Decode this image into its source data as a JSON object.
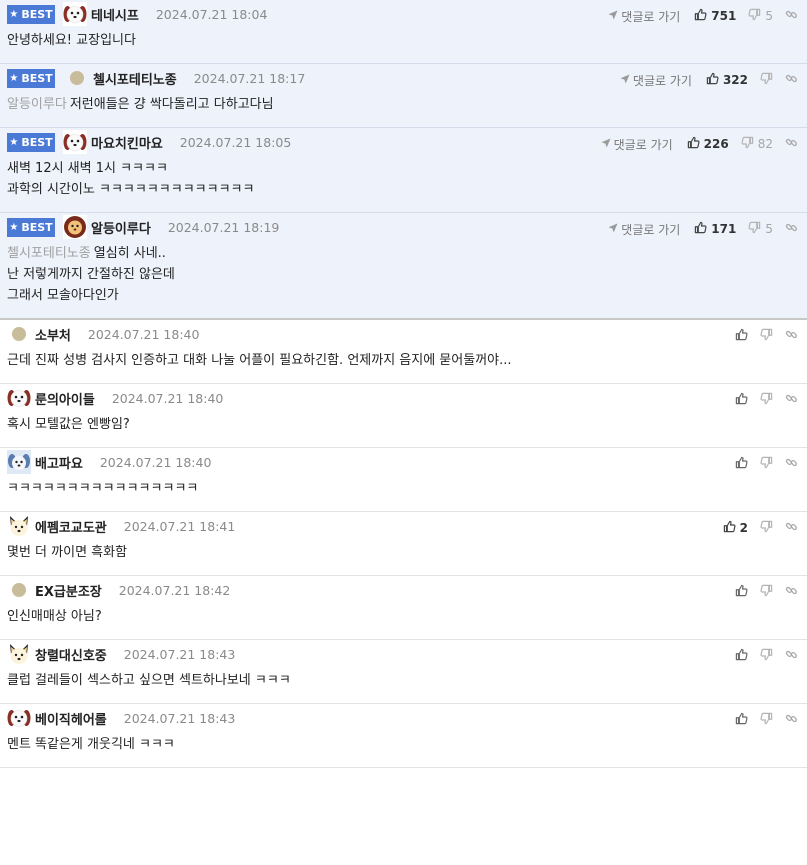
{
  "best_badge": "BEST",
  "reply_label": "댓글로 가기",
  "comments": [
    {
      "best": true,
      "nick": "테네시프",
      "date": "2024.07.21 18:04",
      "likes": "751",
      "dislikes": "5",
      "quote": "",
      "lines": [
        "안녕하세요! 교장입니다"
      ],
      "avatar": "puppy-avatar"
    },
    {
      "best": true,
      "nick": "첼시포테티노종",
      "date": "2024.07.21 18:17",
      "likes": "322",
      "dislikes": "",
      "quote": "알등이루다",
      "lines": [
        "저런애들은 걍 싹다돌리고 다하고다님"
      ],
      "avatar": "dot-avatar"
    },
    {
      "best": true,
      "nick": "마요치킨마요",
      "date": "2024.07.21 18:05",
      "likes": "226",
      "dislikes": "82",
      "quote": "",
      "lines": [
        "새벽 12시 새벽 1시 ㅋㅋㅋㅋ",
        "과학의 시간이노 ㅋㅋㅋㅋㅋㅋㅋㅋㅋㅋㅋㅋㅋ"
      ],
      "avatar": "puppy-avatar"
    },
    {
      "best": true,
      "nick": "알등이루다",
      "date": "2024.07.21 18:19",
      "likes": "171",
      "dislikes": "5",
      "quote": "첼시포테티노종",
      "lines": [
        "열심히 사네..",
        "난 저렇게까지 간절하진 않은데",
        "그래서 모솔아다인가"
      ],
      "avatar": "lion-avatar"
    },
    {
      "best": false,
      "nick": "소부처",
      "date": "2024.07.21 18:40",
      "likes": "",
      "dislikes": "",
      "quote": "",
      "lines": [
        "근데 진짜 성병 검사지 인증하고 대화 나눌 어플이 필요하긴함. 언제까지 음지에 묻어둘꺼야..."
      ],
      "avatar": "dot-avatar"
    },
    {
      "best": false,
      "nick": "룬의아이들",
      "date": "2024.07.21 18:40",
      "likes": "",
      "dislikes": "",
      "quote": "",
      "lines": [
        "혹시 모텔값은 엔빵임?"
      ],
      "avatar": "puppy-avatar"
    },
    {
      "best": false,
      "nick": "배고파요",
      "date": "2024.07.21 18:40",
      "likes": "",
      "dislikes": "",
      "quote": "",
      "lines": [
        "ㅋㅋㅋㅋㅋㅋㅋㅋㅋㅋㅋㅋㅋㅋㅋㅋ"
      ],
      "avatar": "blue-avatar"
    },
    {
      "best": false,
      "nick": "에펨코교도관",
      "date": "2024.07.21 18:41",
      "likes": "2",
      "dislikes": "",
      "quote": "",
      "lines": [
        "몇번 더 까이면 흑화함"
      ],
      "avatar": "shiba-avatar"
    },
    {
      "best": false,
      "nick": "EX급분조장",
      "date": "2024.07.21 18:42",
      "likes": "",
      "dislikes": "",
      "quote": "",
      "lines": [
        "인신매매상 아님?"
      ],
      "avatar": "dot-avatar"
    },
    {
      "best": false,
      "nick": "창렬대신호중",
      "date": "2024.07.21 18:43",
      "likes": "",
      "dislikes": "",
      "quote": "",
      "lines": [
        "클럽 걸레들이 섹스하고 싶으면 섹트하나보네 ㅋㅋㅋ"
      ],
      "avatar": "shiba-avatar"
    },
    {
      "best": false,
      "nick": "베이직헤어롤",
      "date": "2024.07.21 18:43",
      "likes": "",
      "dislikes": "",
      "quote": "",
      "lines": [
        "멘트 똑같은게 개웃긱네 ㅋㅋㅋ"
      ],
      "avatar": "puppy-avatar"
    }
  ],
  "colors": {
    "best_bg": "#eef2fb",
    "badge": "#4a7ad6",
    "muted": "#8a8a8a"
  }
}
